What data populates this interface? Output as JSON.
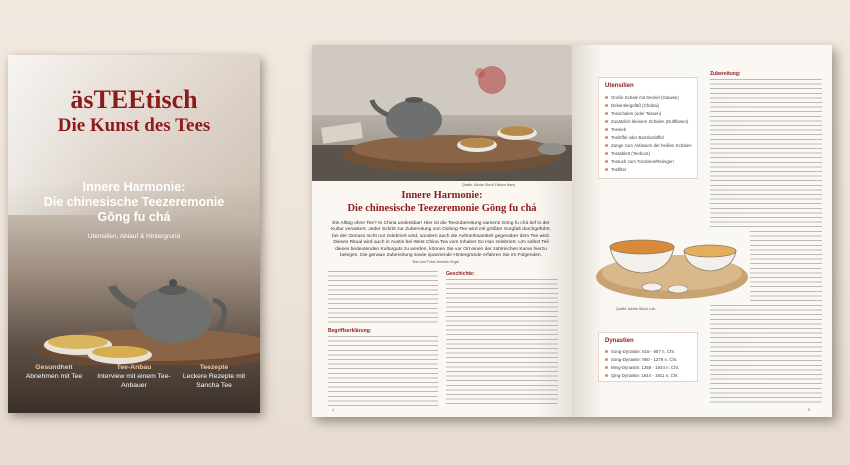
{
  "cover": {
    "title_line1": "äsTEEtisch",
    "title_line2": "Die Kunst des Tees",
    "headline_line1": "Innere Harmonie:",
    "headline_line2": "Die chinesische Teezeremonie",
    "headline_line3": "Gōng fu chá",
    "subtitle": "Utensilien, Ablauf & Hintergrund",
    "teasers": [
      {
        "title": "Gesundheit",
        "text": "Abnehmen mit Tee"
      },
      {
        "title": "Tee-Anbau",
        "text": "Interview mit einem Tee-Anbauer"
      },
      {
        "title": "Teezepte",
        "text": "Leckere Rezepte mit Sancha Tee"
      }
    ]
  },
  "left_page": {
    "photo_caption": "Quelle: Adobe Stock Faborn Harry",
    "article_kicker": "Innere Harmonie:",
    "article_title": "Die chinesische Teezeremonie Gōng fu chá",
    "intro": "Ein Alltag ohne Tee? In China undenkbar! Hier ist die Teezubereitung namens Gōng fu chá tief in der Kultur verankert. Jeder Schritt zur Zubereitung von Oolong-Tee wird mit größter Sorgfalt durchgeführt, bei der Genuss nicht nur zelebriert wird, sondern auch die Aufmerksamkeit gegenüber dem Tee wird. Dieses Ritual wird auch in Austin bei West China Tea vom Inhaber So Han zelebriert. Um selbst Teil dieses bedeutenden Kulturguts zu werden, können Sie vor Ort einen der zahlreichen Kurse hierzu belegen. Die genaue Zubereitung sowie spannende Hintergründe erfahren Sie im Folgenden.",
    "author": "Text und Fotos Henrike Engel",
    "col1_heading": "Begriffserklärung:",
    "col2_heading": "Geschichte:",
    "page_number": "4"
  },
  "right_page": {
    "utensils_title": "Utensilien",
    "utensils": [
      "Große Schale mit Deckel (Gaiwan)",
      "Dekantiergefäß (Chahai)",
      "Teeschalen (oder Tassen)",
      "Zusätzlich kleinere Schalen (Duftflasen)",
      "Teesieb",
      "Teelöffel oder Bambuslöffel",
      "Zange zum Anfassen der heißen Schalen",
      "Teetablett (Teeboot)",
      "Teetuch zum Trocknen/Reinigen",
      "Teefilter"
    ],
    "dynasties_title": "Dynastien",
    "dynasties": [
      "Song-Dynastie: 618 - 907 n. Chr.",
      "Song-Dynastie: 960 - 1279 n. Chr.",
      "Ming-Dynastie: 1368 - 1644 n. Chr.",
      "Qing-Dynastie: 1644 - 1911 n. Chr."
    ],
    "section_heading": "Zubereitung:",
    "illustration_caption": "Quelle: Adobe Stock Lulu",
    "page_number": "5"
  },
  "colors": {
    "accent": "#8c1c1c",
    "box_border": "#e6d3c5",
    "page": "#fbf8f4"
  }
}
